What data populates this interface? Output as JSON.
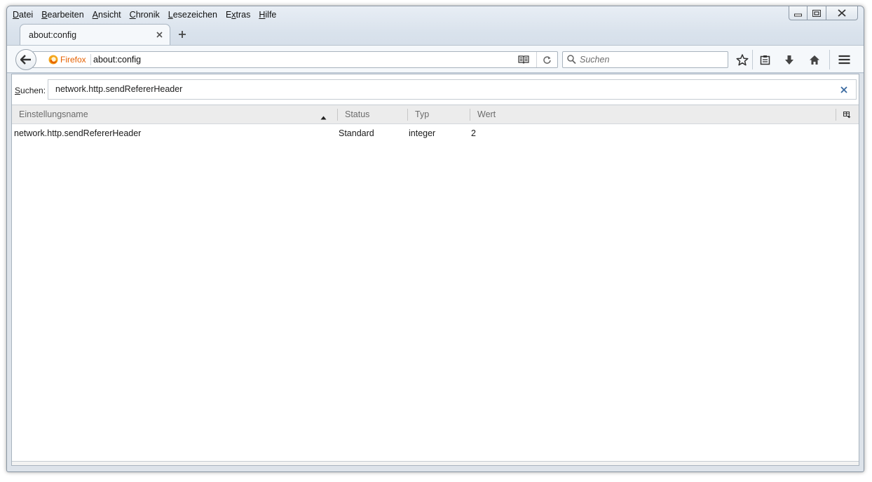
{
  "menubar": {
    "items": [
      {
        "pre": "",
        "accel": "D",
        "post": "atei"
      },
      {
        "pre": "",
        "accel": "B",
        "post": "earbeiten"
      },
      {
        "pre": "",
        "accel": "A",
        "post": "nsicht"
      },
      {
        "pre": "",
        "accel": "C",
        "post": "hronik"
      },
      {
        "pre": "",
        "accel": "L",
        "post": "esezeichen"
      },
      {
        "pre": "E",
        "accel": "x",
        "post": "tras"
      },
      {
        "pre": "",
        "accel": "H",
        "post": "ilfe"
      }
    ]
  },
  "tab": {
    "title": "about:config"
  },
  "navbar": {
    "identity_label": "Firefox",
    "url": "about:config",
    "search_placeholder": "Suchen"
  },
  "filter": {
    "label_accel": "S",
    "label_rest": "uchen:",
    "value": "network.http.sendRefererHeader"
  },
  "columns": {
    "name": "Einstellungsname",
    "status": "Status",
    "type": "Typ",
    "value": "Wert",
    "sort_direction": "ascending"
  },
  "rows": [
    {
      "name": "network.http.sendRefererHeader",
      "status": "Standard",
      "type": "integer",
      "value": "2"
    }
  ],
  "colors": {
    "identity": "#e66000",
    "header_bg": "#ececec",
    "chrome_bg": "#f5f8fb"
  }
}
